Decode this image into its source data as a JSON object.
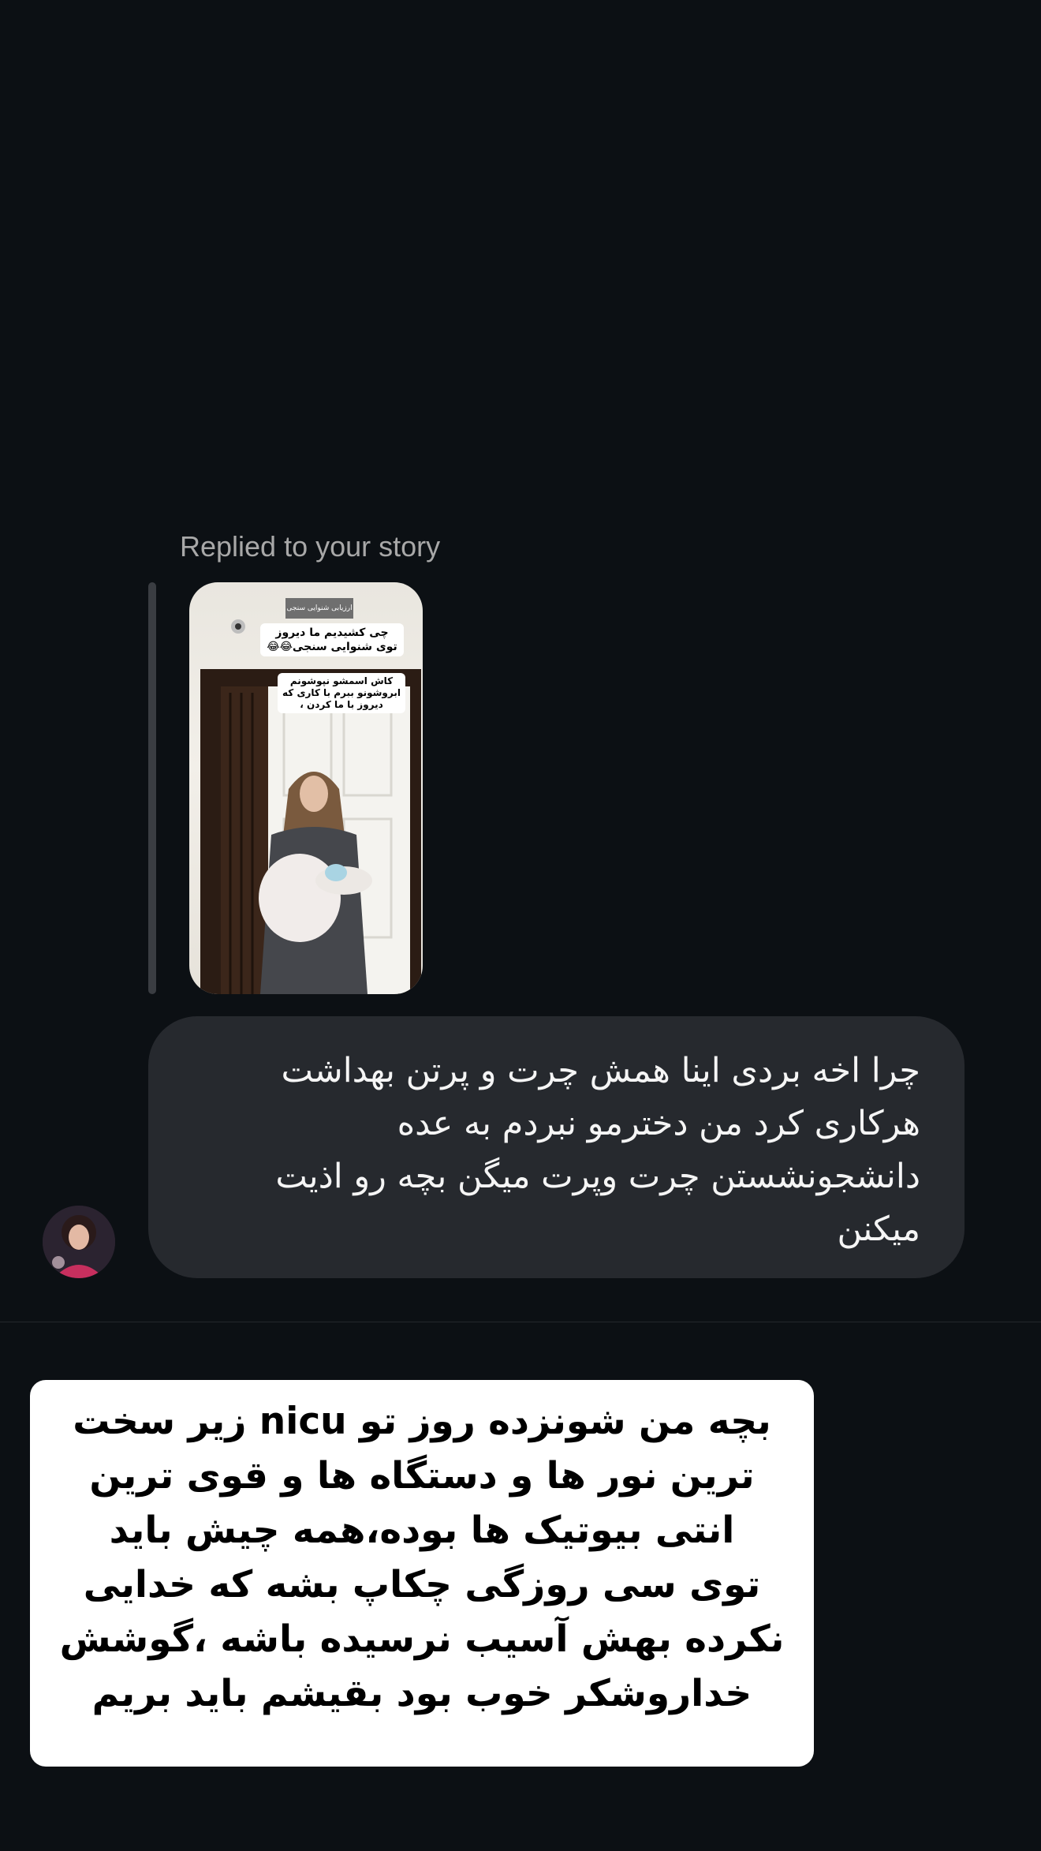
{
  "thread": {
    "replied_label": "Replied to your story",
    "story_captions": {
      "top": "چی کشیدیم ما دیروز توی شنوایی سنجی😂😂",
      "bottom": "کاش اسمشو نپوشونم ابروشونو ببرم با کاری که دیروز با ما کردن ،",
      "door_sign": "ارزیابی شنوایی سنجی"
    },
    "message_lines": [
      "چرا اخه بردی اینا همش چرت و پرتن بهداشت",
      "هرکاری کرد من دخترمو نبردم به عده",
      "دانشجونشستن چرت وپرت میگن بچه رو اذیت",
      "میکنن"
    ]
  },
  "story_card": {
    "lines": [
      "بچه من شونزده روز تو nicu زیر سخت",
      "ترین نور ها و دستگاه ها و قوی ترین",
      "انتی بیوتیک ها بوده،همه چیش باید",
      "توی سی روزگی چکاپ بشه که خدایی",
      "نکرده بهش آسیب نرسیده باشه ،گوشش",
      "خداروشکر خوب بود بقیشم باید بریم"
    ]
  },
  "colors": {
    "background": "#0c1014",
    "bubble": "#26292e",
    "muted_text": "#a8a8a8",
    "card": "#ffffff"
  }
}
